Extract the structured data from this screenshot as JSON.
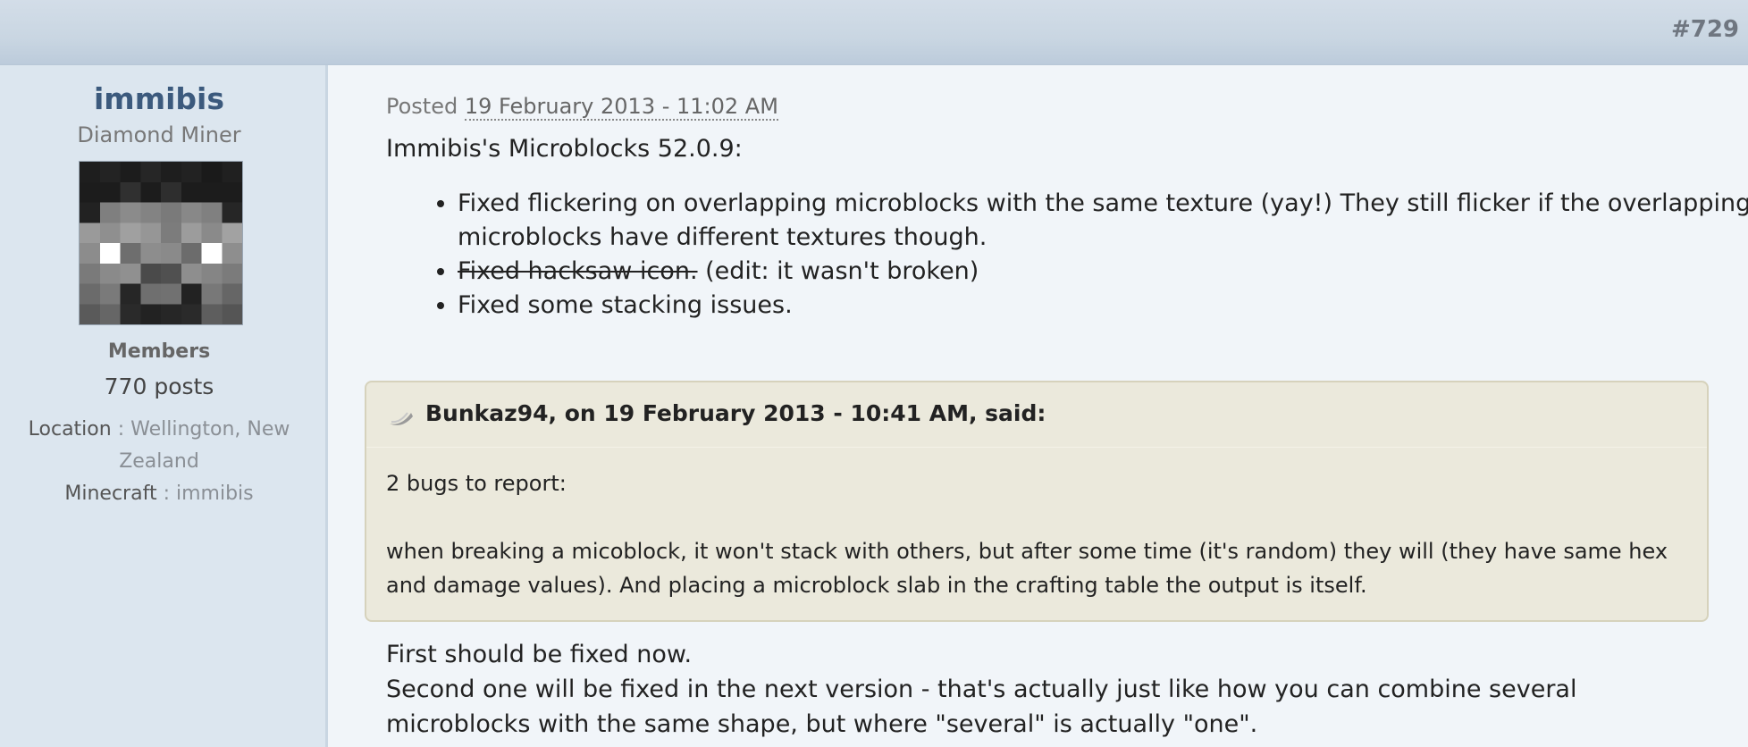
{
  "post": {
    "number": "#729"
  },
  "author": {
    "username": "immibis",
    "rank": "Diamond Miner",
    "group": "Members",
    "posts": "770 posts",
    "location_label": "Location",
    "location_value": "Wellington, New Zealand",
    "minecraft_label": "Minecraft",
    "minecraft_value": "immibis",
    "separator": " : "
  },
  "content": {
    "posted_label": "Posted",
    "posted_date": "19 February 2013 - 11:02 AM",
    "intro": "Immibis's Microblocks 52.0.9:",
    "changes": [
      {
        "text": "Fixed flickering on overlapping microblocks with the same texture (yay!) They still flicker if the overlapping microblocks have different textures though."
      },
      {
        "strike": "Fixed hacksaw icon.",
        "text": " (edit: it wasn't broken)"
      },
      {
        "text": "Fixed some stacking issues."
      }
    ],
    "quote": {
      "citation": "Bunkaz94, on 19 February 2013 - 10:41 AM, said:",
      "paragraphs": [
        "2 bugs to report:",
        "when breaking a micoblock, it won't stack with others, but after some time (it's random) they will (they have same hex and damage values). And placing a microblock slab in the crafting table the output is itself."
      ]
    },
    "reply": [
      "First should be fixed now.",
      "Second one will be fixed in the next version - that's actually just like how you can combine several microblocks with the same shape, but where \"several\" is actually \"one\"."
    ]
  }
}
